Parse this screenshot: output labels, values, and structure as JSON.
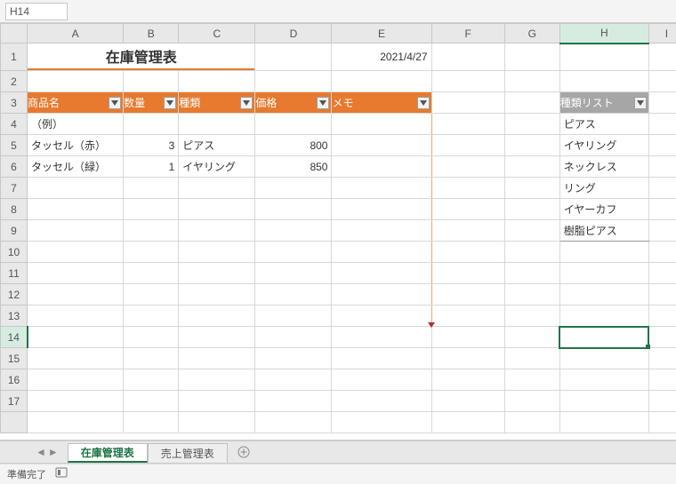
{
  "namebox": {
    "value": "H14"
  },
  "columns": [
    "A",
    "B",
    "C",
    "D",
    "E",
    "F",
    "G",
    "H",
    "I"
  ],
  "rows": [
    "1",
    "2",
    "3",
    "4",
    "5",
    "6",
    "7",
    "8",
    "9",
    "10",
    "11",
    "12",
    "13",
    "14",
    "15",
    "16",
    "17"
  ],
  "title": "在庫管理表",
  "date": "2021/4/27",
  "table_headers": {
    "name": "商品名",
    "qty": "数量",
    "type": "種類",
    "price": "価格",
    "memo": "メモ"
  },
  "table_rows": [
    {
      "name": "（例）",
      "qty": "",
      "type": "",
      "price": "",
      "memo": ""
    },
    {
      "name": "タッセル（赤）",
      "qty": "3",
      "type": "ピアス",
      "price": "800",
      "memo": ""
    },
    {
      "name": "タッセル（緑）",
      "qty": "1",
      "type": "イヤリング",
      "price": "850",
      "memo": ""
    }
  ],
  "list_header": "種類リスト",
  "list_items": [
    "ピアス",
    "イヤリング",
    "ネックレス",
    "リング",
    "イヤーカフ",
    "樹脂ピアス"
  ],
  "sheet_tabs": {
    "active": "在庫管理表",
    "other": "売上管理表"
  },
  "status": {
    "ready": "準備完了"
  }
}
